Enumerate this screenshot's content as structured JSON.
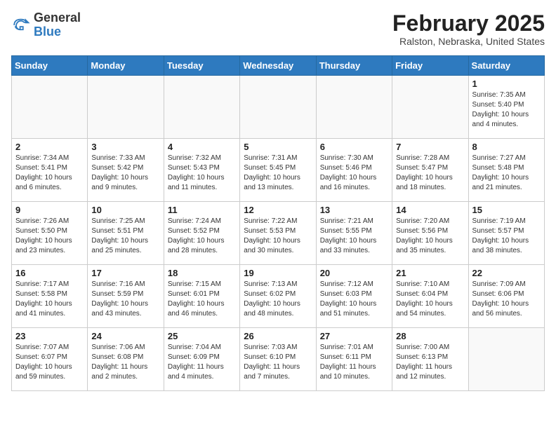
{
  "header": {
    "logo_general": "General",
    "logo_blue": "Blue",
    "month_year": "February 2025",
    "location": "Ralston, Nebraska, United States"
  },
  "weekdays": [
    "Sunday",
    "Monday",
    "Tuesday",
    "Wednesday",
    "Thursday",
    "Friday",
    "Saturday"
  ],
  "weeks": [
    [
      {
        "day": "",
        "info": ""
      },
      {
        "day": "",
        "info": ""
      },
      {
        "day": "",
        "info": ""
      },
      {
        "day": "",
        "info": ""
      },
      {
        "day": "",
        "info": ""
      },
      {
        "day": "",
        "info": ""
      },
      {
        "day": "1",
        "info": "Sunrise: 7:35 AM\nSunset: 5:40 PM\nDaylight: 10 hours and 4 minutes."
      }
    ],
    [
      {
        "day": "2",
        "info": "Sunrise: 7:34 AM\nSunset: 5:41 PM\nDaylight: 10 hours and 6 minutes."
      },
      {
        "day": "3",
        "info": "Sunrise: 7:33 AM\nSunset: 5:42 PM\nDaylight: 10 hours and 9 minutes."
      },
      {
        "day": "4",
        "info": "Sunrise: 7:32 AM\nSunset: 5:43 PM\nDaylight: 10 hours and 11 minutes."
      },
      {
        "day": "5",
        "info": "Sunrise: 7:31 AM\nSunset: 5:45 PM\nDaylight: 10 hours and 13 minutes."
      },
      {
        "day": "6",
        "info": "Sunrise: 7:30 AM\nSunset: 5:46 PM\nDaylight: 10 hours and 16 minutes."
      },
      {
        "day": "7",
        "info": "Sunrise: 7:28 AM\nSunset: 5:47 PM\nDaylight: 10 hours and 18 minutes."
      },
      {
        "day": "8",
        "info": "Sunrise: 7:27 AM\nSunset: 5:48 PM\nDaylight: 10 hours and 21 minutes."
      }
    ],
    [
      {
        "day": "9",
        "info": "Sunrise: 7:26 AM\nSunset: 5:50 PM\nDaylight: 10 hours and 23 minutes."
      },
      {
        "day": "10",
        "info": "Sunrise: 7:25 AM\nSunset: 5:51 PM\nDaylight: 10 hours and 25 minutes."
      },
      {
        "day": "11",
        "info": "Sunrise: 7:24 AM\nSunset: 5:52 PM\nDaylight: 10 hours and 28 minutes."
      },
      {
        "day": "12",
        "info": "Sunrise: 7:22 AM\nSunset: 5:53 PM\nDaylight: 10 hours and 30 minutes."
      },
      {
        "day": "13",
        "info": "Sunrise: 7:21 AM\nSunset: 5:55 PM\nDaylight: 10 hours and 33 minutes."
      },
      {
        "day": "14",
        "info": "Sunrise: 7:20 AM\nSunset: 5:56 PM\nDaylight: 10 hours and 35 minutes."
      },
      {
        "day": "15",
        "info": "Sunrise: 7:19 AM\nSunset: 5:57 PM\nDaylight: 10 hours and 38 minutes."
      }
    ],
    [
      {
        "day": "16",
        "info": "Sunrise: 7:17 AM\nSunset: 5:58 PM\nDaylight: 10 hours and 41 minutes."
      },
      {
        "day": "17",
        "info": "Sunrise: 7:16 AM\nSunset: 5:59 PM\nDaylight: 10 hours and 43 minutes."
      },
      {
        "day": "18",
        "info": "Sunrise: 7:15 AM\nSunset: 6:01 PM\nDaylight: 10 hours and 46 minutes."
      },
      {
        "day": "19",
        "info": "Sunrise: 7:13 AM\nSunset: 6:02 PM\nDaylight: 10 hours and 48 minutes."
      },
      {
        "day": "20",
        "info": "Sunrise: 7:12 AM\nSunset: 6:03 PM\nDaylight: 10 hours and 51 minutes."
      },
      {
        "day": "21",
        "info": "Sunrise: 7:10 AM\nSunset: 6:04 PM\nDaylight: 10 hours and 54 minutes."
      },
      {
        "day": "22",
        "info": "Sunrise: 7:09 AM\nSunset: 6:06 PM\nDaylight: 10 hours and 56 minutes."
      }
    ],
    [
      {
        "day": "23",
        "info": "Sunrise: 7:07 AM\nSunset: 6:07 PM\nDaylight: 10 hours and 59 minutes."
      },
      {
        "day": "24",
        "info": "Sunrise: 7:06 AM\nSunset: 6:08 PM\nDaylight: 11 hours and 2 minutes."
      },
      {
        "day": "25",
        "info": "Sunrise: 7:04 AM\nSunset: 6:09 PM\nDaylight: 11 hours and 4 minutes."
      },
      {
        "day": "26",
        "info": "Sunrise: 7:03 AM\nSunset: 6:10 PM\nDaylight: 11 hours and 7 minutes."
      },
      {
        "day": "27",
        "info": "Sunrise: 7:01 AM\nSunset: 6:11 PM\nDaylight: 11 hours and 10 minutes."
      },
      {
        "day": "28",
        "info": "Sunrise: 7:00 AM\nSunset: 6:13 PM\nDaylight: 11 hours and 12 minutes."
      },
      {
        "day": "",
        "info": ""
      }
    ]
  ]
}
